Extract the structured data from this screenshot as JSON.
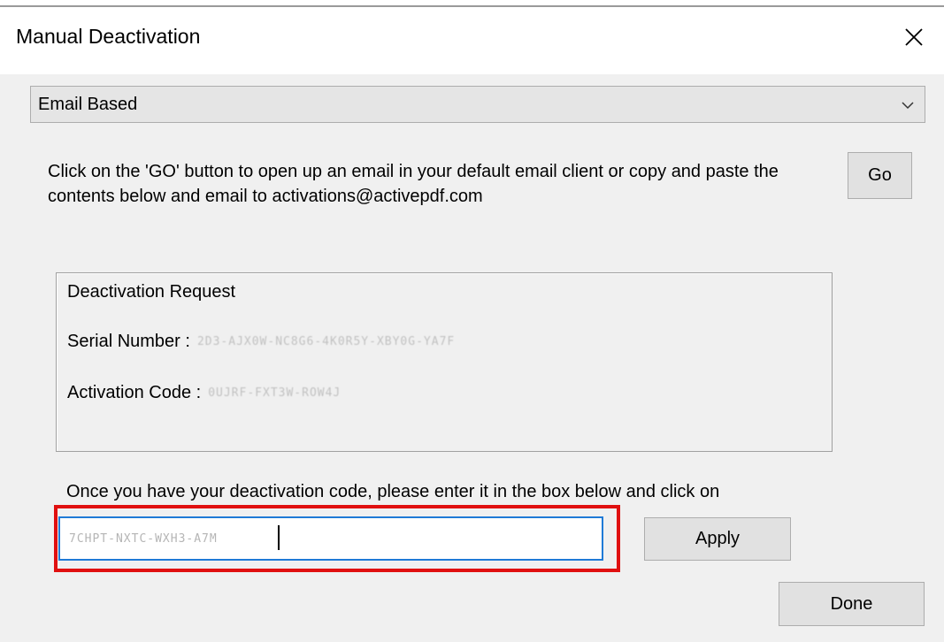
{
  "window": {
    "title": "Manual Deactivation",
    "close_icon": "close-icon"
  },
  "method_select": {
    "selected": "Email Based",
    "arrow_icon": "chevron-down-icon"
  },
  "info": {
    "text": "Click on the 'GO' button to open up an email in your default email client or copy and paste the contents below and email to activations@activepdf.com"
  },
  "buttons": {
    "go": "Go",
    "apply": "Apply",
    "done": "Done"
  },
  "request": {
    "title": "Deactivation Request",
    "serial_label": "Serial Number :",
    "serial_value": "2D3-AJX0W-NC8G6-4K0R5Y-XBY0G-YA7F",
    "activation_label": "Activation Code :",
    "activation_value": "0UJRF-FXT3W-ROW4J"
  },
  "deactivation": {
    "instruction": "Once you have your deactivation code, please enter it in the box below and click on",
    "code_value": "7CHPT-NXTC-WXH3-A7M"
  },
  "colors": {
    "highlight": "#e01010",
    "input_focus": "#1f7ad6",
    "dialog_bg": "#f0f0f0"
  }
}
